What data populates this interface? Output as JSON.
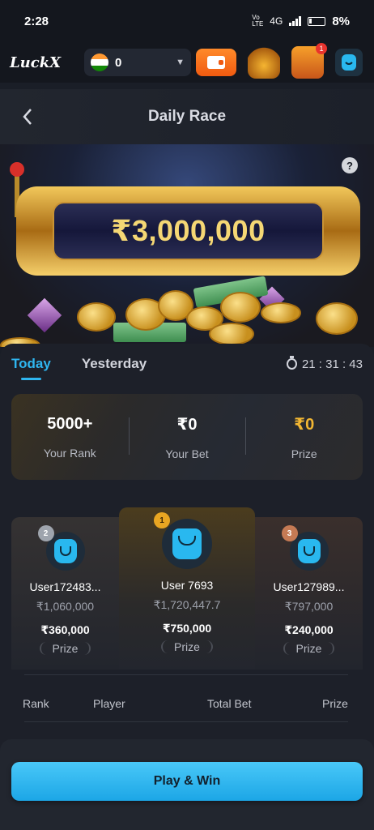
{
  "status_bar": {
    "time": "2:28",
    "network_volte": "Vo LTE",
    "network": "4G",
    "battery": "8%"
  },
  "header": {
    "logo": "LuckX",
    "balance": "0",
    "icons": [
      "india-flag-icon",
      "chevron-down-icon",
      "wallet-icon",
      "gold-pot-icon",
      "treasure-chest-icon",
      "avatar-icon"
    ],
    "notification_count": "1"
  },
  "nav": {
    "title": "Daily Race"
  },
  "hero": {
    "jackpot": "₹3,000,000",
    "help": "?"
  },
  "tabs": [
    {
      "label": "Today",
      "active": true
    },
    {
      "label": "Yesterday",
      "active": false
    }
  ],
  "timer": "21 : 31 : 43",
  "stats": [
    {
      "value": "5000+",
      "label": "Your Rank"
    },
    {
      "value": "₹0",
      "label": "Your Bet"
    },
    {
      "value": "₹0",
      "label": "Prize"
    }
  ],
  "podium": {
    "first": {
      "rank": "1",
      "name": "User 7693",
      "bet": "₹1,720,447.7",
      "prize": "₹750,000",
      "prize_label": "Prize"
    },
    "second": {
      "rank": "2",
      "name": "User172483...",
      "bet": "₹1,060,000",
      "prize": "₹360,000",
      "prize_label": "Prize"
    },
    "third": {
      "rank": "3",
      "name": "User127989...",
      "bet": "₹797,000",
      "prize": "₹240,000",
      "prize_label": "Prize"
    }
  },
  "table_headers": [
    "Rank",
    "Player",
    "Total Bet",
    "Prize"
  ],
  "cta": {
    "label": "Play & Win"
  },
  "colors": {
    "accent": "#2fb6f0",
    "gold": "#f2b632",
    "button": "#2bb5ef"
  }
}
